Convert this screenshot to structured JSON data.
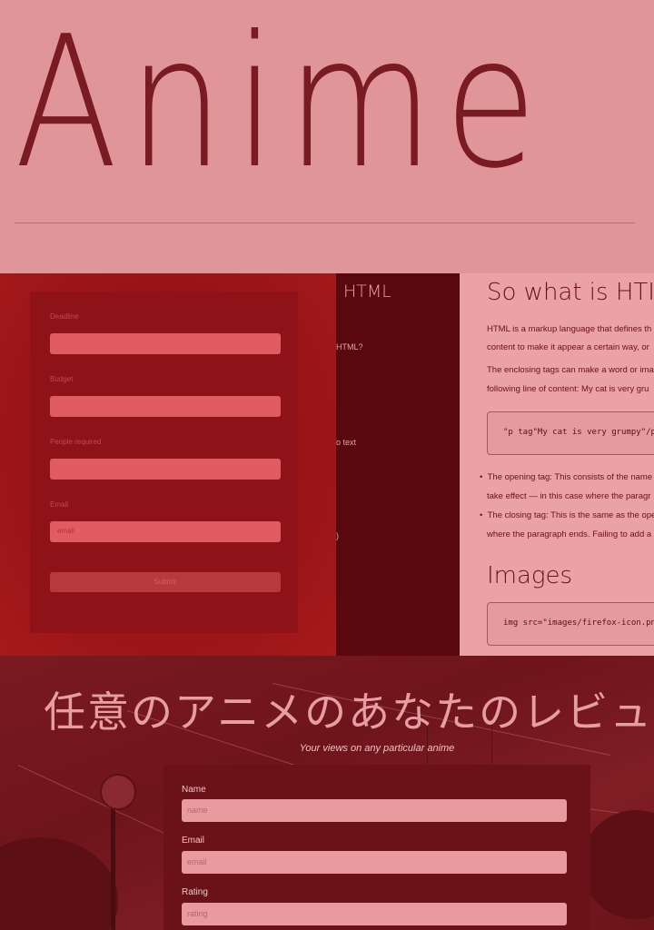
{
  "hero": {
    "title": "Anime"
  },
  "project_form": {
    "fields": [
      {
        "label": "Deadline",
        "placeholder": ""
      },
      {
        "label": "Budget",
        "placeholder": ""
      },
      {
        "label": "People required",
        "placeholder": ""
      },
      {
        "label": "Email",
        "placeholder": "email"
      }
    ],
    "submit_label": "Submit"
  },
  "nav": {
    "title": "HTML",
    "items": [
      "HTML?",
      "o text",
      ")"
    ]
  },
  "doc": {
    "heading": "So what is HTI",
    "para1_line1": "HTML is a markup language that defines th",
    "para1_line2": "content to make it appear a certain way, or",
    "para2_line1": "The enclosing tags can make a word or ima",
    "para2_line2": "following line of content: My cat is very gru",
    "code1": "\"p tag\"My cat is very grumpy\"/p",
    "bullet1_line1": "The opening tag: This consists of the name",
    "bullet1_line2": "take effect — in this case where the paragr",
    "bullet2_line1": "The closing tag: This is the same as the ope",
    "bullet2_line2": "where the paragraph ends. Failing to add a",
    "heading2": "Images",
    "code2": "img src=\"images/firefox-icon.pn"
  },
  "review": {
    "title": "任意のアニメのあなたのレビュ",
    "subtitle": "Your views on any particular anime",
    "fields": [
      {
        "label": "Name",
        "placeholder": "name"
      },
      {
        "label": "Email",
        "placeholder": "email"
      },
      {
        "label": "Rating",
        "placeholder": "rating"
      }
    ]
  }
}
